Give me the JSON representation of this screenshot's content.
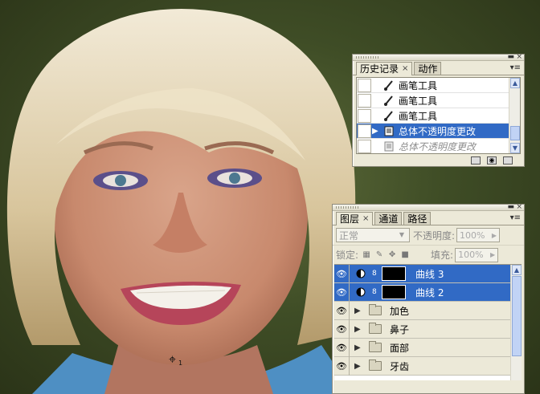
{
  "history_panel": {
    "tabs": [
      {
        "label": "历史记录",
        "close": "×"
      },
      {
        "label": "动作"
      }
    ],
    "minimize": "▬",
    "close": "×",
    "menu": "▾≡",
    "items": [
      {
        "label": "画笔工具",
        "icon": "brush-icon",
        "state": "normal"
      },
      {
        "label": "画笔工具",
        "icon": "brush-icon",
        "state": "normal"
      },
      {
        "label": "画笔工具",
        "icon": "brush-icon",
        "state": "normal"
      },
      {
        "label": "总体不透明度更改",
        "icon": "history-step-icon",
        "state": "selected"
      },
      {
        "label": "总体不透明度更改",
        "icon": "history-step-icon",
        "state": "dimmed"
      }
    ],
    "footer_icons": [
      "new-document-icon",
      "snapshot-icon",
      "trash-icon"
    ]
  },
  "layers_panel": {
    "tabs": [
      {
        "label": "图层",
        "close": "×"
      },
      {
        "label": "通道"
      },
      {
        "label": "路径"
      }
    ],
    "minimize": "▬",
    "close": "×",
    "menu": "▾≡",
    "blend_mode": "正常",
    "opacity_label": "不透明度:",
    "opacity_value": "100%",
    "lock_label": "锁定:",
    "fill_label": "填充:",
    "fill_value": "100%",
    "layers": [
      {
        "name": "曲线 3",
        "type": "adjustment",
        "selected": true
      },
      {
        "name": "曲线 2",
        "type": "adjustment",
        "selected": true
      },
      {
        "name": "加色",
        "type": "group",
        "selected": false
      },
      {
        "name": "鼻子",
        "type": "group",
        "selected": false
      },
      {
        "name": "面部",
        "type": "group",
        "selected": false
      },
      {
        "name": "牙齿",
        "type": "group",
        "selected": false
      }
    ]
  },
  "cursor": {
    "label": "1"
  },
  "colors": {
    "selection": "#316ac5",
    "panel_bg": "#ece9d8"
  }
}
